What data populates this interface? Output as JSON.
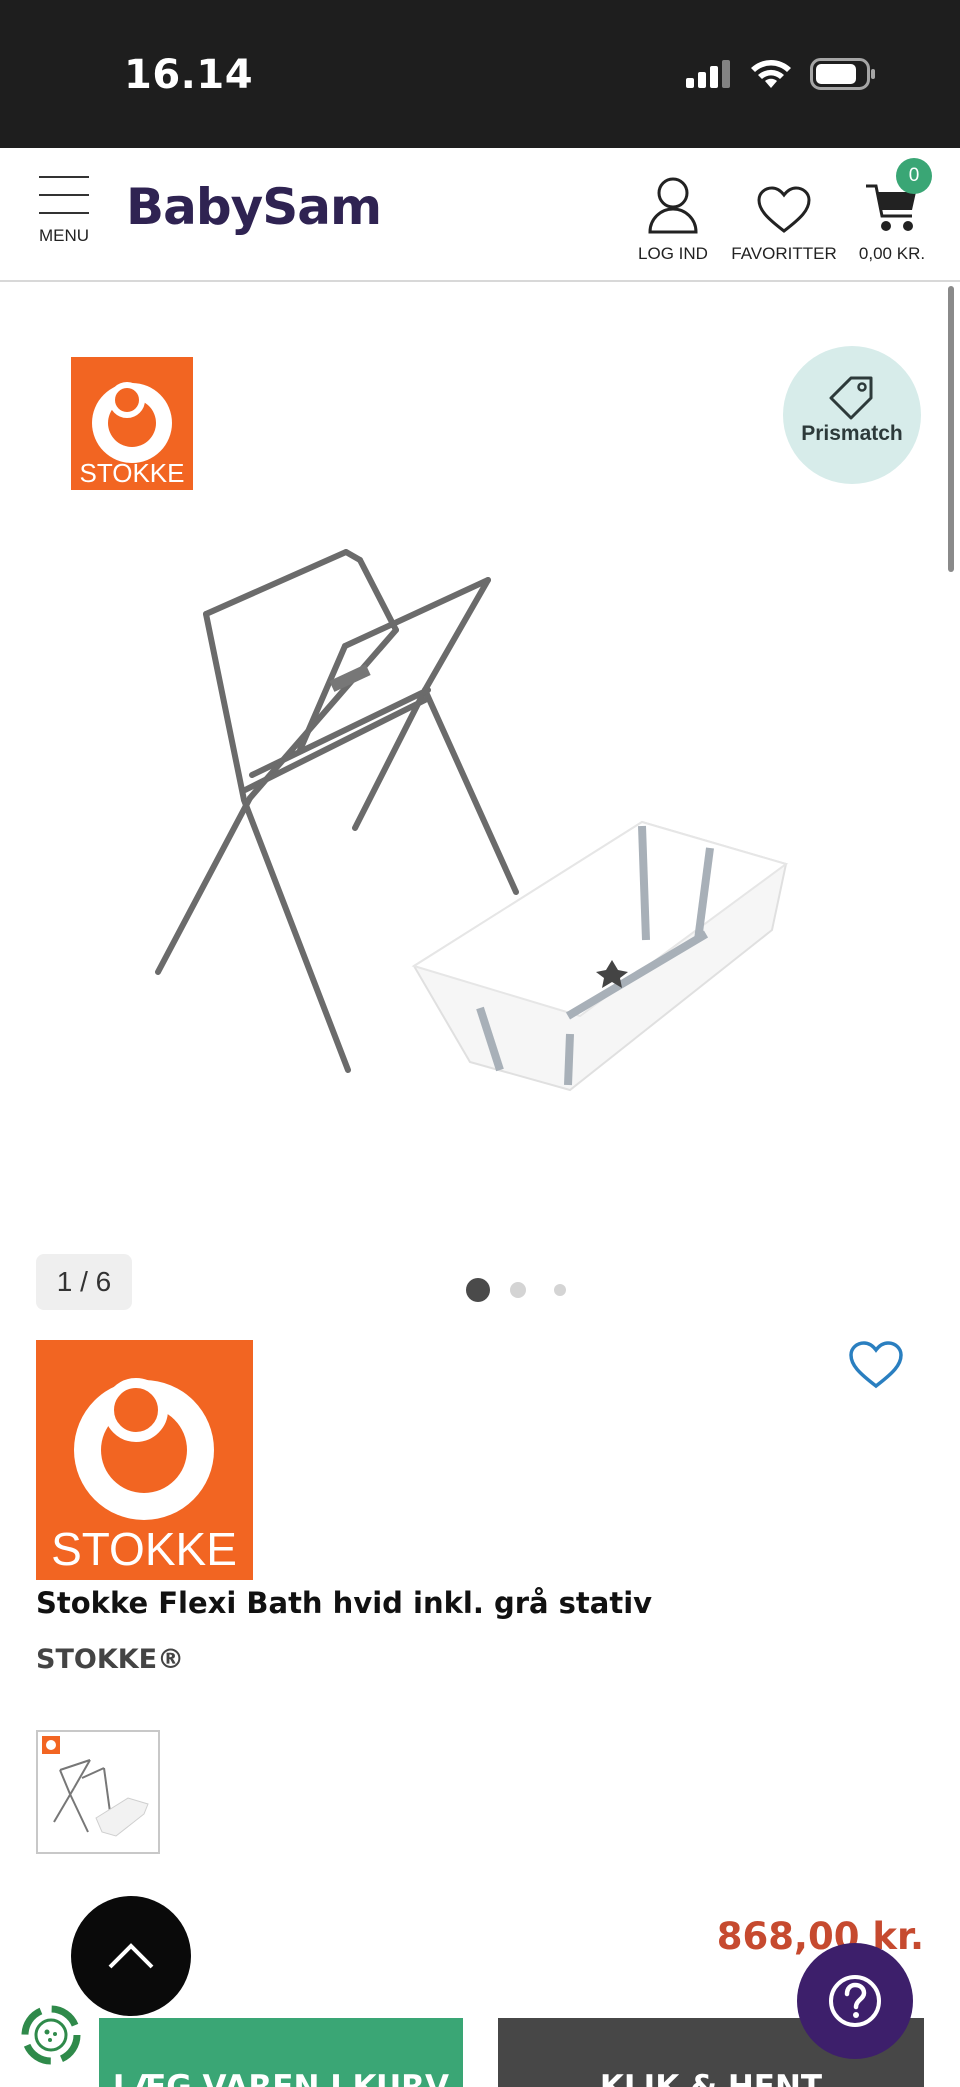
{
  "status_bar": {
    "time": "16.14"
  },
  "header": {
    "menu_label": "MENU",
    "logo": "BabySam",
    "login_label": "LOG IND",
    "favorites_label": "FAVORITTER",
    "cart_total": "0,00 KR.",
    "cart_count": "0"
  },
  "gallery": {
    "brand_logo_text": "STOKKE",
    "prismatch_label": "Prismatch",
    "counter": "1 / 6"
  },
  "product": {
    "brand_logo_text": "STOKKE",
    "title": "Stokke Flexi Bath hvid inkl. grå stativ",
    "brand": "STOKKE®",
    "price": "868,00 kr."
  },
  "actions": {
    "add_to_cart": "LÆG VAREN I KURV",
    "click_collect": "KLIK & HENT"
  },
  "colors": {
    "brand_purple": "#2f2352",
    "accent_green": "#3aa675",
    "price_red": "#c64a2f",
    "stokke_orange": "#f26522"
  }
}
